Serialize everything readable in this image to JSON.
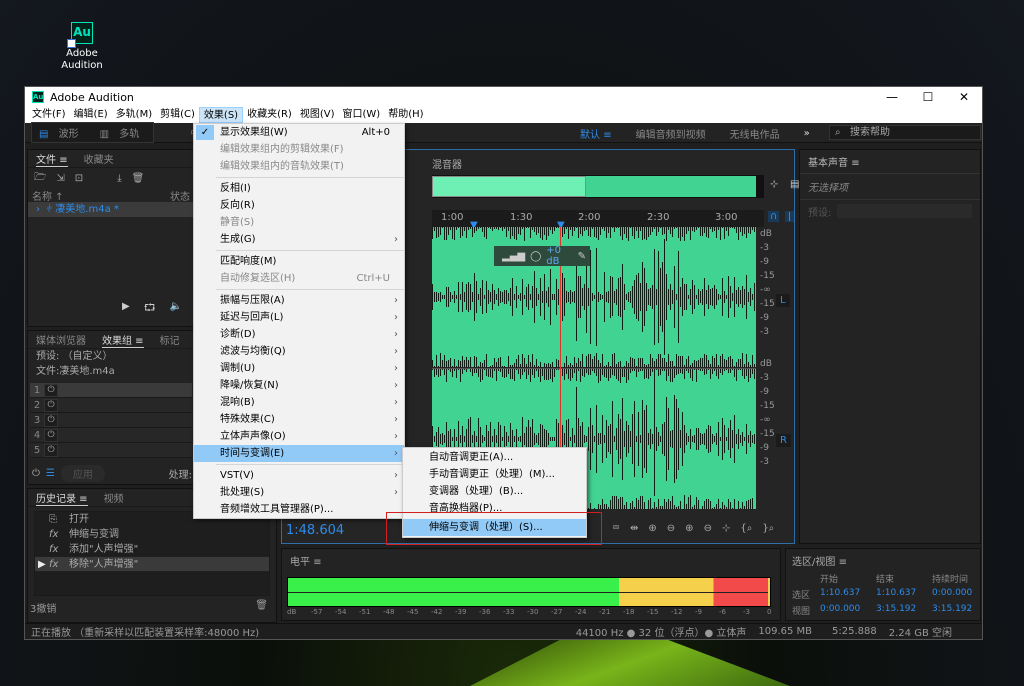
{
  "desktop": {
    "icon_label_1": "Adobe",
    "icon_label_2": "Audition",
    "icon_glyph": "Au"
  },
  "window": {
    "title": "Adobe Audition",
    "logo": "Au",
    "min": "—",
    "max": "☐",
    "close": "✕"
  },
  "menubar": [
    "文件(F)",
    "编辑(E)",
    "多轨(M)",
    "剪辑(C)",
    "效果(S)",
    "收藏夹(R)",
    "视图(V)",
    "窗口(W)",
    "帮助(H)"
  ],
  "toolbar": {
    "waveform": "波形",
    "multitrack": "多轨",
    "workspaces": [
      "默认",
      "编辑音频到视频",
      "无线电作品"
    ],
    "workspace_menu": "≡",
    "more": "»",
    "search_placeholder": "搜索帮助"
  },
  "files_panel": {
    "tabs": [
      "文件",
      "收藏夹"
    ],
    "menu": "≡",
    "col_name": "名称 ↑",
    "col_status": "状态",
    "file": "凄美地.m4a *"
  },
  "effects_panel": {
    "tabs": [
      "媒体浏览器",
      "效果组",
      "标记"
    ],
    "preset_label": "预设:",
    "preset_value": "（自定义）",
    "file_label": "文件:凄美地.m4a",
    "slots": [
      "1",
      "2",
      "3",
      "4",
      "5"
    ],
    "apply": "应用",
    "process_label": "处理:"
  },
  "history_panel": {
    "tabs": [
      "历史记录",
      "视频"
    ],
    "items": [
      "打开",
      "伸缩与变调",
      "添加\"人声增强\"",
      "移除\"人声增强\""
    ],
    "undo_count": "3撤销"
  },
  "editor": {
    "tab": "混音器",
    "time_ticks": [
      "1:00",
      "1:30",
      "2:00",
      "2:30",
      "3:00"
    ],
    "hud_gain": "+0 dB",
    "db_labels": [
      "dB",
      "-3",
      "-9",
      "-15",
      "-∞",
      "-15",
      "-9",
      "-3"
    ],
    "ch_left": "L",
    "ch_right": "R",
    "current_time": "1:48.604"
  },
  "effects_menu": {
    "items": [
      {
        "label": "显示效果组(W)",
        "shortcut": "Alt+0",
        "checked": true
      },
      {
        "label": "编辑效果组内的剪辑效果(F)",
        "disabled": true
      },
      {
        "label": "编辑效果组内的音轨效果(T)",
        "disabled": true
      },
      {
        "sep": true
      },
      {
        "label": "反相(I)"
      },
      {
        "label": "反向(R)"
      },
      {
        "label": "静音(S)",
        "disabled": true
      },
      {
        "label": "生成(G)",
        "submenu": true
      },
      {
        "sep": true
      },
      {
        "label": "匹配响度(M)"
      },
      {
        "label": "自动修复选区(H)",
        "shortcut": "Ctrl+U",
        "disabled": true
      },
      {
        "sep": true
      },
      {
        "label": "振幅与压限(A)",
        "submenu": true
      },
      {
        "label": "延迟与回声(L)",
        "submenu": true
      },
      {
        "label": "诊断(D)",
        "submenu": true
      },
      {
        "label": "滤波与均衡(Q)",
        "submenu": true
      },
      {
        "label": "调制(U)",
        "submenu": true
      },
      {
        "label": "降噪/恢复(N)",
        "submenu": true
      },
      {
        "label": "混响(B)",
        "submenu": true
      },
      {
        "label": "特殊效果(C)",
        "submenu": true
      },
      {
        "label": "立体声声像(O)",
        "submenu": true
      },
      {
        "label": "时间与变调(E)",
        "submenu": true,
        "highlighted": true
      },
      {
        "sep": true
      },
      {
        "label": "VST(V)",
        "submenu": true
      },
      {
        "label": "批处理(S)",
        "submenu": true
      },
      {
        "label": "音频增效工具管理器(P)..."
      }
    ]
  },
  "time_pitch_submenu": {
    "items": [
      "自动音调更正(A)...",
      "手动音调更正（处理）(M)...",
      "变调器（处理）(B)...",
      "音高换档器(P)...",
      "伸缩与变调（处理）(S)..."
    ],
    "highlighted_index": 4
  },
  "levels_panel": {
    "title": "电平",
    "menu": "≡",
    "scale": [
      "dB",
      "-57",
      "-54",
      "-51",
      "-48",
      "-45",
      "-42",
      "-39",
      "-36",
      "-33",
      "-30",
      "-27",
      "-24",
      "-21",
      "-18",
      "-15",
      "-12",
      "-9",
      "-6",
      "-3",
      "0"
    ]
  },
  "selection_panel": {
    "title": "选区/视图",
    "menu": "≡",
    "headers": [
      "开始",
      "结束",
      "持续时间"
    ],
    "rows": [
      {
        "label": "选区",
        "values": [
          "1:10.637",
          "1:10.637",
          "0:00.000"
        ]
      },
      {
        "label": "视图",
        "values": [
          "0:00.000",
          "3:15.192",
          "3:15.192"
        ]
      }
    ]
  },
  "essential_sound": {
    "title": "基本声音",
    "menu": "≡",
    "empty": "无选择项",
    "preset_label": "预设:"
  },
  "statusbar": {
    "left": "正在播放 （重新采样以匹配装置采样率:48000 Hz)",
    "format": "44100 Hz ● 32 位（浮点）● 立体声",
    "size": "109.65 MB",
    "duration": "5:25.888",
    "free": "2.24 GB 空闲"
  }
}
